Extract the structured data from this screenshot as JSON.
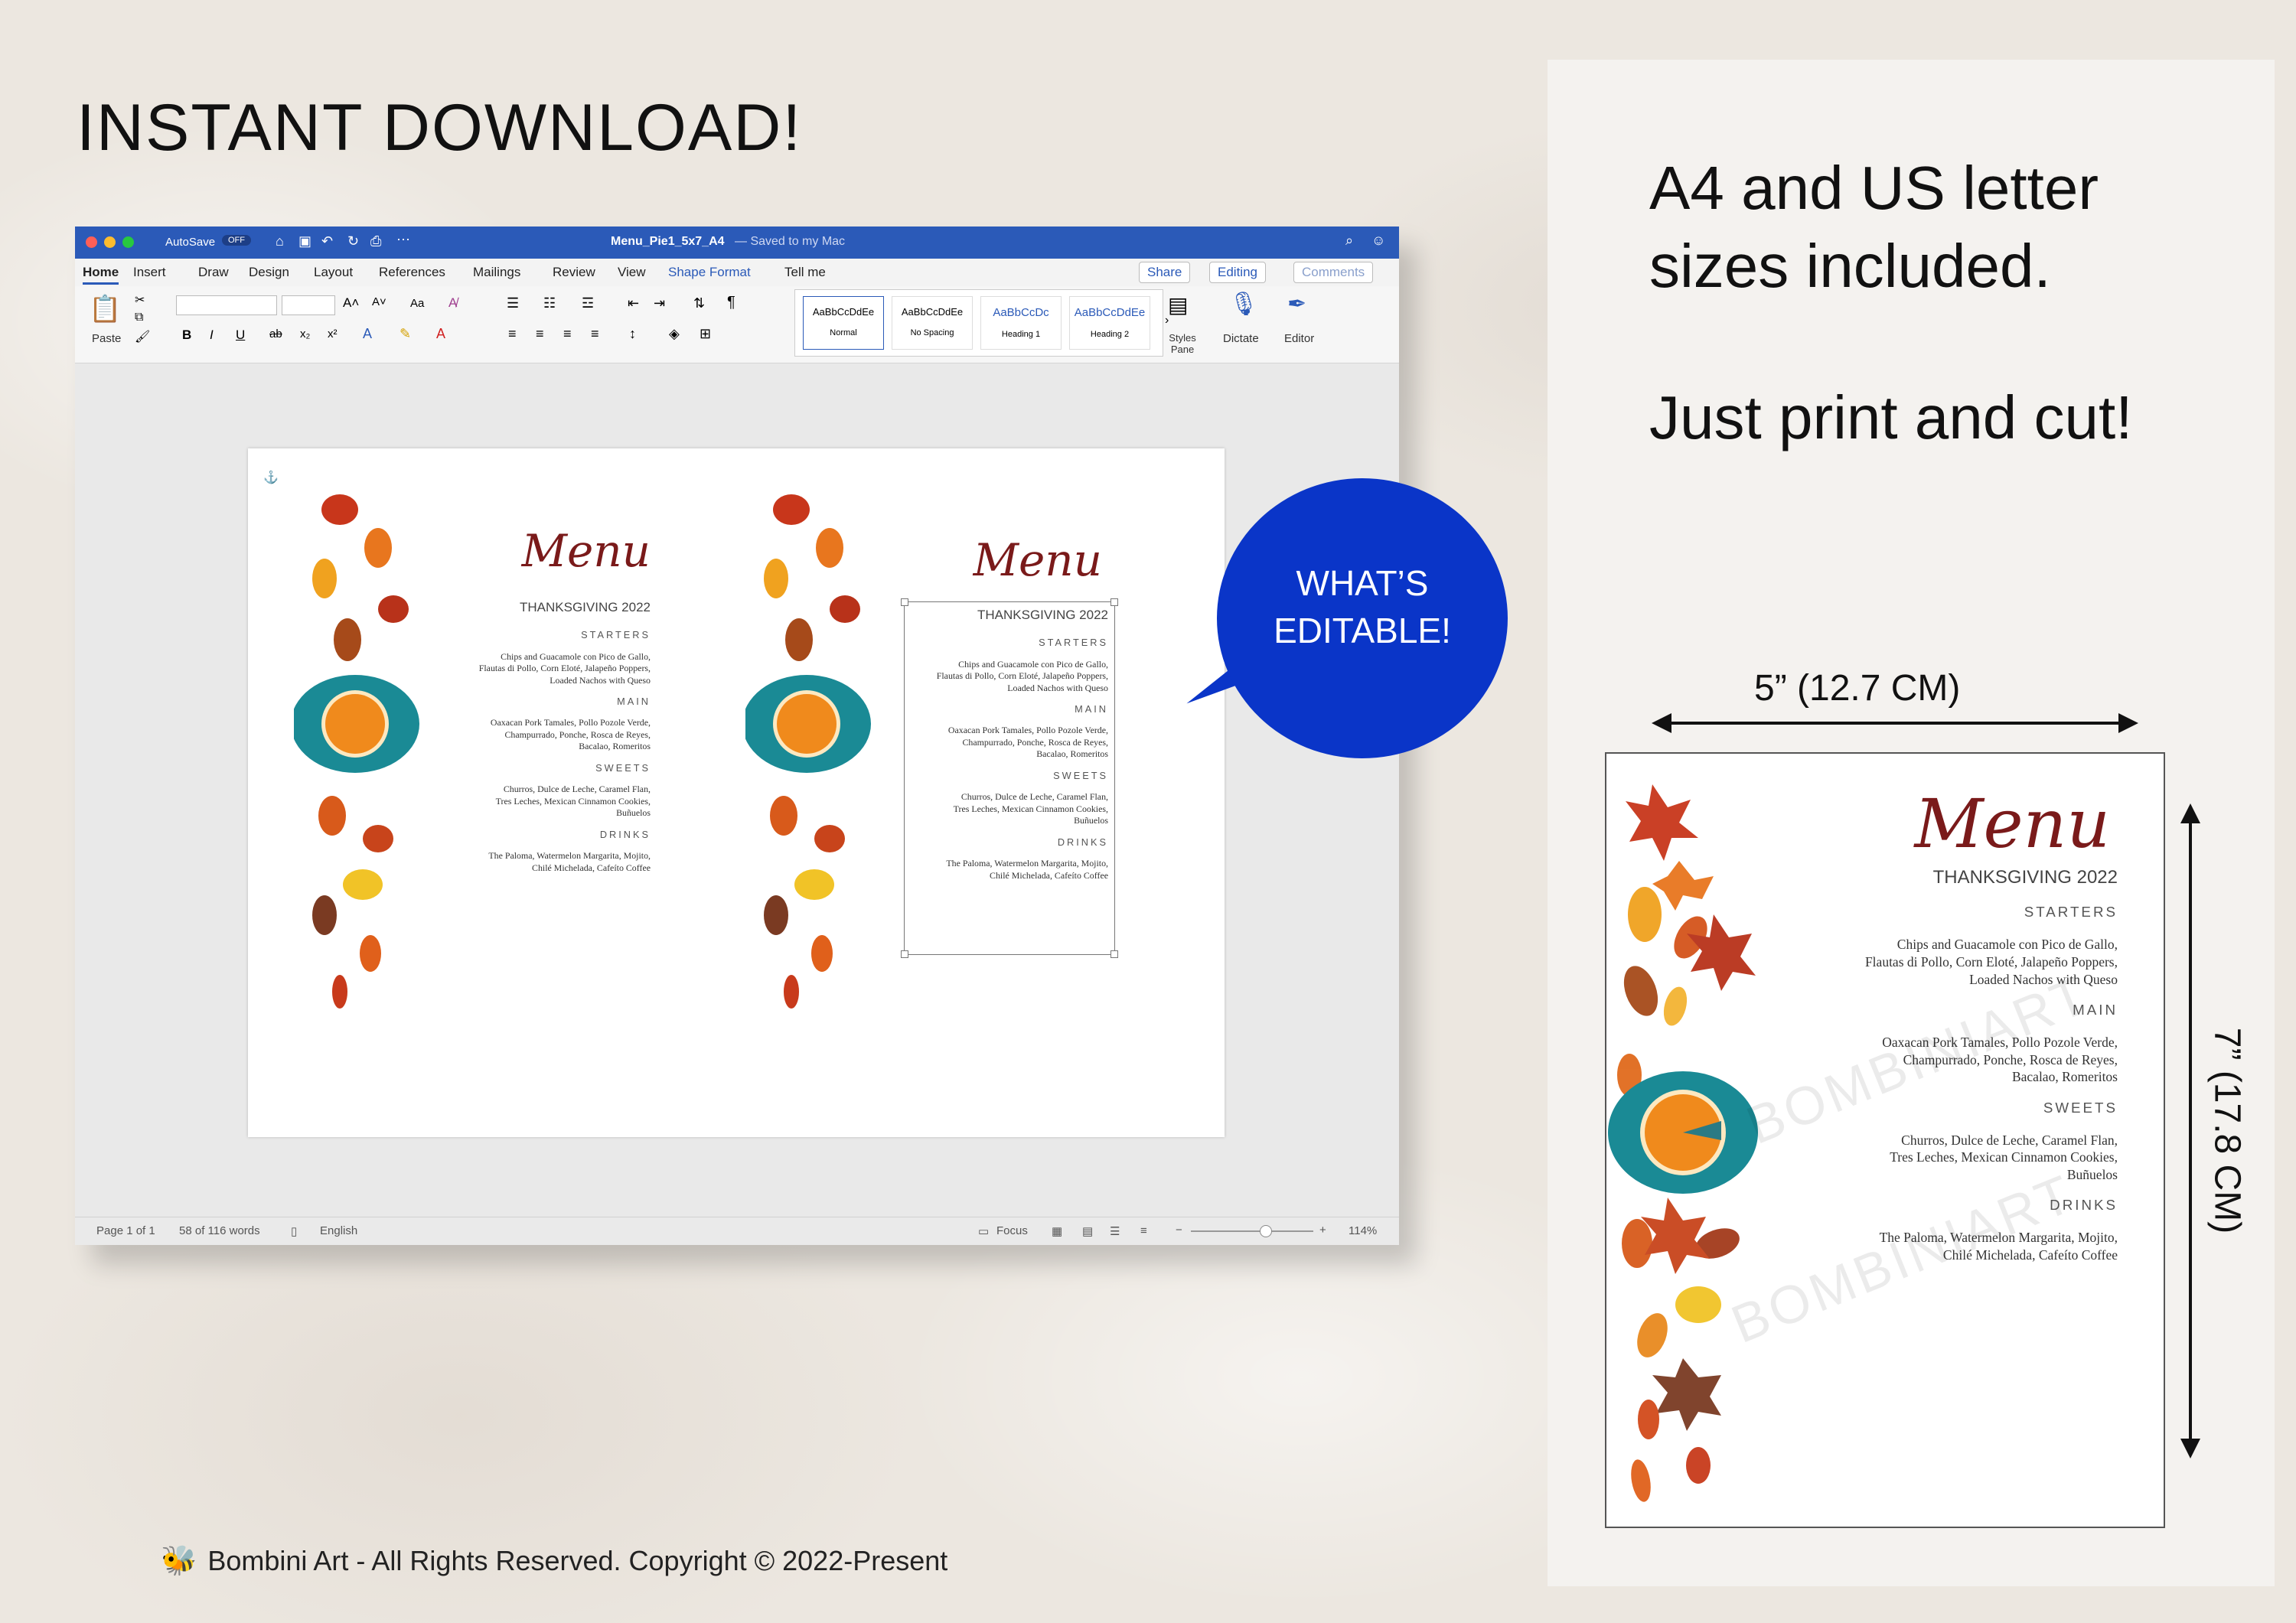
{
  "headline": "INSTANT DOWNLOAD!",
  "right_panel": {
    "line1": "A4 and US letter",
    "line2": "sizes included.",
    "line3": "Just print and cut!",
    "width_label": "5” (12.7 CM)",
    "height_label": "7” (17.8 CM)"
  },
  "footer": "Bombini Art - All Rights Reserved. Copyright © 2022-Present",
  "bubble": {
    "line1": "WHAT’S",
    "line2": "EDITABLE!"
  },
  "word": {
    "autosave": "AutoSave",
    "autosave_state": "OFF",
    "doc_title": "Menu_Pie1_5x7_A4",
    "saved": "— Saved to my Mac",
    "tabs": [
      "Home",
      "Insert",
      "Draw",
      "Design",
      "Layout",
      "References",
      "Mailings",
      "Review",
      "View",
      "Shape Format"
    ],
    "tell_me": "Tell me",
    "share": "Share",
    "editing": "Editing",
    "comments": "Comments",
    "paste": "Paste",
    "styles": [
      {
        "sample": "AaBbCcDdEe",
        "name": "Normal"
      },
      {
        "sample": "AaBbCcDdEe",
        "name": "No Spacing"
      },
      {
        "sample": "AaBbCcDc",
        "name": "Heading 1"
      },
      {
        "sample": "AaBbCcDdEe",
        "name": "Heading 2"
      }
    ],
    "styles_pane": "Styles Pane",
    "dictate": "Dictate",
    "editor": "Editor",
    "status": {
      "page": "Page 1 of 1",
      "words": "58 of 116 words",
      "language": "English",
      "focus": "Focus",
      "zoom": "114%"
    }
  },
  "menu_card": {
    "script": "Menu",
    "event": "THANKSGIVING 2022",
    "sections": [
      {
        "title": "STARTERS",
        "items": [
          "Chips and Guacamole con Pico de Gallo,",
          "Flautas di Pollo, Corn Eloté, Jalapeño Poppers,",
          "Loaded Nachos with Queso"
        ]
      },
      {
        "title": "MAIN",
        "items": [
          "Oaxacan Pork Tamales, Pollo Pozole Verde,",
          "Champurrado, Ponche, Rosca de Reyes,",
          "Bacalao, Romeritos"
        ]
      },
      {
        "title": "SWEETS",
        "items": [
          "Churros, Dulce de Leche, Caramel Flan,",
          "Tres Leches, Mexican Cinnamon Cookies,",
          "Buñuelos"
        ]
      },
      {
        "title": "DRINKS",
        "items": [
          "The Paloma, Watermelon Margarita, Mojito,",
          "Chilé Michelada, Cafeíto Coffee"
        ]
      }
    ]
  },
  "watermark": "BOMBINIART",
  "colors": {
    "accent_blue": "#0a35c8",
    "word_blue": "#2b5ab8",
    "menu_red": "#7a1a1a",
    "pie_teal": "#1a8a95",
    "pie_orange": "#f08a1c"
  }
}
